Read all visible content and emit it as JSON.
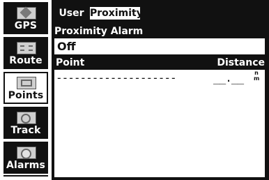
{
  "sidebar": {
    "items": [
      {
        "label": "GPS",
        "icon": "satellite-icon",
        "selected": false
      },
      {
        "label": "Route",
        "icon": "route-icon",
        "selected": false
      },
      {
        "label": "Points",
        "icon": "waypoint-flag-icon",
        "selected": true
      },
      {
        "label": "Track",
        "icon": "track-icon",
        "selected": false
      },
      {
        "label": "Alarms",
        "icon": "alarm-clock-icon",
        "selected": false
      }
    ]
  },
  "tabs": [
    {
      "label": "User",
      "selected": false
    },
    {
      "label": "Proximity",
      "selected": true
    }
  ],
  "proximity_alarm": {
    "label": "Proximity Alarm",
    "value": "Off"
  },
  "table": {
    "columns": [
      "Point",
      "Distance"
    ],
    "rows": [
      {
        "point": "--------------------",
        "distance": "__.__",
        "unit_top": "n",
        "unit_bottom": "m"
      }
    ]
  },
  "colors": {
    "background": "#ffffff",
    "dark_frame": "#111111",
    "text_dark": "#111111",
    "text_light": "#ffffff"
  }
}
